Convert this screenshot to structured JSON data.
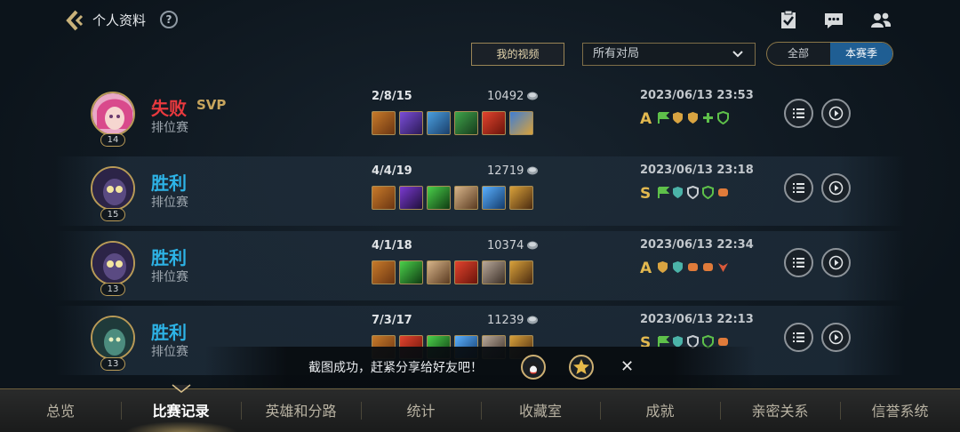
{
  "header": {
    "title": "个人资料",
    "help": "?"
  },
  "filters": {
    "my_video": "我的视频",
    "match_type": "所有对局",
    "season_all": "全部",
    "season_current": "本赛季"
  },
  "matches": [
    {
      "result": "失败",
      "svp": "SVP",
      "mode": "排位赛",
      "level": "14",
      "kda": "2/8/15",
      "gold": "10492",
      "time": "2023/06/13 23:53",
      "grade": "A"
    },
    {
      "result": "胜利",
      "mode": "排位赛",
      "level": "15",
      "kda": "4/4/19",
      "gold": "12719",
      "time": "2023/06/13 23:18",
      "grade": "S"
    },
    {
      "result": "胜利",
      "mode": "排位赛",
      "level": "13",
      "kda": "4/1/18",
      "gold": "10374",
      "time": "2023/06/13 22:34",
      "grade": "A"
    },
    {
      "result": "胜利",
      "mode": "排位赛",
      "level": "13",
      "kda": "7/3/17",
      "gold": "11239",
      "time": "2023/06/13 22:13",
      "grade": "S"
    }
  ],
  "toast": {
    "text": "截图成功，赶紧分享给好友吧！",
    "close": "✕"
  },
  "nav": {
    "items": [
      "总览",
      "比赛记录",
      "英雄和分路",
      "统计",
      "收藏室",
      "成就",
      "亲密关系",
      "信誉系统"
    ],
    "active": "比赛记录"
  },
  "colors": {
    "win": "#2db3e6",
    "lose": "#e8393e",
    "gold_accent": "#c8a55d",
    "season_active": "#1f5e93"
  }
}
